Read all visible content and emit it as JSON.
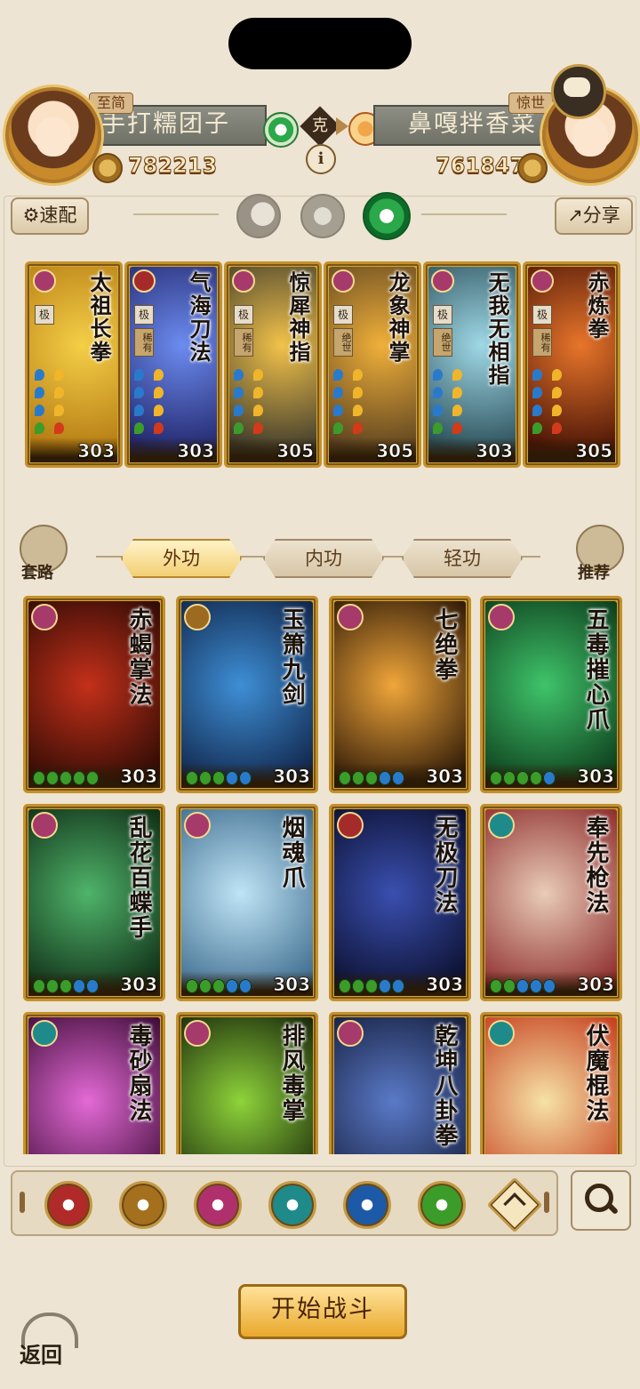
{
  "left_player": {
    "name": "手打糯团子",
    "rank": "至简",
    "power": "782213"
  },
  "right_player": {
    "name": "鼻嘎拌香菜",
    "rank": "惊世",
    "power": "761847"
  },
  "versus_label": "克",
  "info_label": "i",
  "top_controls": {
    "quick_match": "速配",
    "share": "分享"
  },
  "deck_cards": [
    {
      "title": "太祖长拳",
      "grade": "极",
      "rarity": "",
      "cost": "303",
      "emblem": "#a63a6a",
      "art": [
        "#f5cf47",
        "#b47a12"
      ]
    },
    {
      "title": "气海刀法",
      "grade": "极",
      "rarity": "稀有",
      "cost": "303",
      "emblem": "#a52a2a",
      "art": [
        "#6c8cf0",
        "#22266a"
      ]
    },
    {
      "title": "惊犀神指",
      "grade": "极",
      "rarity": "稀有",
      "cost": "305",
      "emblem": "#a63a6a",
      "art": [
        "#f2c24a",
        "#3d3a2c"
      ]
    },
    {
      "title": "龙象神掌",
      "grade": "极",
      "rarity": "绝世",
      "cost": "305",
      "emblem": "#a63a6a",
      "art": [
        "#f0b03a",
        "#5b4220"
      ]
    },
    {
      "title": "无我无相指",
      "grade": "极",
      "rarity": "绝世",
      "cost": "303",
      "emblem": "#a63a6a",
      "art": [
        "#9fd8e6",
        "#2a4e58"
      ]
    },
    {
      "title": "赤炼拳",
      "grade": "极",
      "rarity": "稀有",
      "cost": "305",
      "emblem": "#a63a6a",
      "art": [
        "#e8752b",
        "#4a1406"
      ]
    }
  ],
  "tabs": {
    "left_icon_label": "套路",
    "waigong": "外功",
    "neigong": "内功",
    "qinggong": "轻功",
    "right_icon_label": "推荐"
  },
  "skill_cards": [
    {
      "title": "赤蝎掌法",
      "cost": "303",
      "emblem": "#a63a6a",
      "art": [
        "#c4301a",
        "#2a0a04"
      ],
      "gems": [
        "#3c9c2a",
        "#3c9c2a",
        "#3c9c2a",
        "#3c9c2a",
        "#3c9c2a"
      ]
    },
    {
      "title": "玉箫九剑",
      "cost": "303",
      "emblem": "#9c6a20",
      "art": [
        "#3e8fd6",
        "#0f2246"
      ],
      "gems": [
        "#3c9c2a",
        "#3c9c2a",
        "#3c9c2a",
        "#2a7acc",
        "#2a7acc"
      ]
    },
    {
      "title": "七绝拳",
      "cost": "303",
      "emblem": "#a63a6a",
      "art": [
        "#f0a63a",
        "#2a1606"
      ],
      "gems": [
        "#3c9c2a",
        "#3c9c2a",
        "#3c9c2a",
        "#2a7acc",
        "#2a7acc"
      ]
    },
    {
      "title": "五毒摧心爪",
      "cost": "303",
      "emblem": "#a63a6a",
      "art": [
        "#3fc46a",
        "#0c3a1a"
      ],
      "gems": [
        "#3c9c2a",
        "#3c9c2a",
        "#3c9c2a",
        "#3c9c2a",
        "#2a7acc"
      ]
    },
    {
      "title": "乱花百蝶手",
      "cost": "303",
      "emblem": "#a63a6a",
      "art": [
        "#4fb46a",
        "#0e2a14"
      ],
      "gems": [
        "#3c9c2a",
        "#3c9c2a",
        "#3c9c2a",
        "#2a7acc",
        "#2a7acc"
      ]
    },
    {
      "title": "烟魂爪",
      "cost": "303",
      "emblem": "#a63a6a",
      "art": [
        "#bfe4f6",
        "#3c6a8c"
      ],
      "gems": [
        "#3c9c2a",
        "#3c9c2a",
        "#3c9c2a",
        "#2a7acc",
        "#2a7acc"
      ]
    },
    {
      "title": "无极刀法",
      "cost": "303",
      "emblem": "#a52a2a",
      "art": [
        "#3a4fb0",
        "#0a0e2a"
      ],
      "gems": [
        "#3c9c2a",
        "#3c9c2a",
        "#3c9c2a",
        "#2a7acc",
        "#2a7acc"
      ]
    },
    {
      "title": "奉先枪法",
      "cost": "303",
      "emblem": "#1f8a8a",
      "art": [
        "#e9ccb8",
        "#8c2a2a"
      ],
      "gems": [
        "#3c9c2a",
        "#3c9c2a",
        "#2a7acc",
        "#2a7acc",
        "#2a7acc"
      ]
    },
    {
      "title": "毒砂扇法",
      "cost": "",
      "emblem": "#1f8a8a",
      "art": [
        "#e46ad6",
        "#3a0a34"
      ],
      "gems": []
    },
    {
      "title": "排风毒掌",
      "cost": "",
      "emblem": "#a63a6a",
      "art": [
        "#8ed43a",
        "#16220a"
      ],
      "gems": []
    },
    {
      "title": "乾坤八卦拳",
      "cost": "",
      "emblem": "#a63a6a",
      "art": [
        "#5a7ac8",
        "#141c3a"
      ],
      "gems": []
    },
    {
      "title": "伏魔棍法",
      "cost": "",
      "emblem": "#1f8a8a",
      "art": [
        "#f6e2a6",
        "#c43a1a"
      ],
      "gems": []
    }
  ],
  "filter_icons": [
    {
      "name": "saber-filter-icon",
      "color": "#b02a2a"
    },
    {
      "name": "sword-filter-icon",
      "color": "#a4701e"
    },
    {
      "name": "fist-filter-icon",
      "color": "#b0306e"
    },
    {
      "name": "fan-filter-icon",
      "color": "#1f8a8a"
    },
    {
      "name": "taiji-filter-icon",
      "color": "#1c5aa8"
    },
    {
      "name": "hidden-weapon-filter-icon",
      "color": "#3c9c2a"
    },
    {
      "name": "misc-filter-icon",
      "color": "#e9c36a"
    }
  ],
  "start_button": "开始战斗",
  "back_label": "返回",
  "colors": {
    "background": "#ede4d3",
    "gold": "#c4912a",
    "accent_green": "#2aa84a"
  }
}
